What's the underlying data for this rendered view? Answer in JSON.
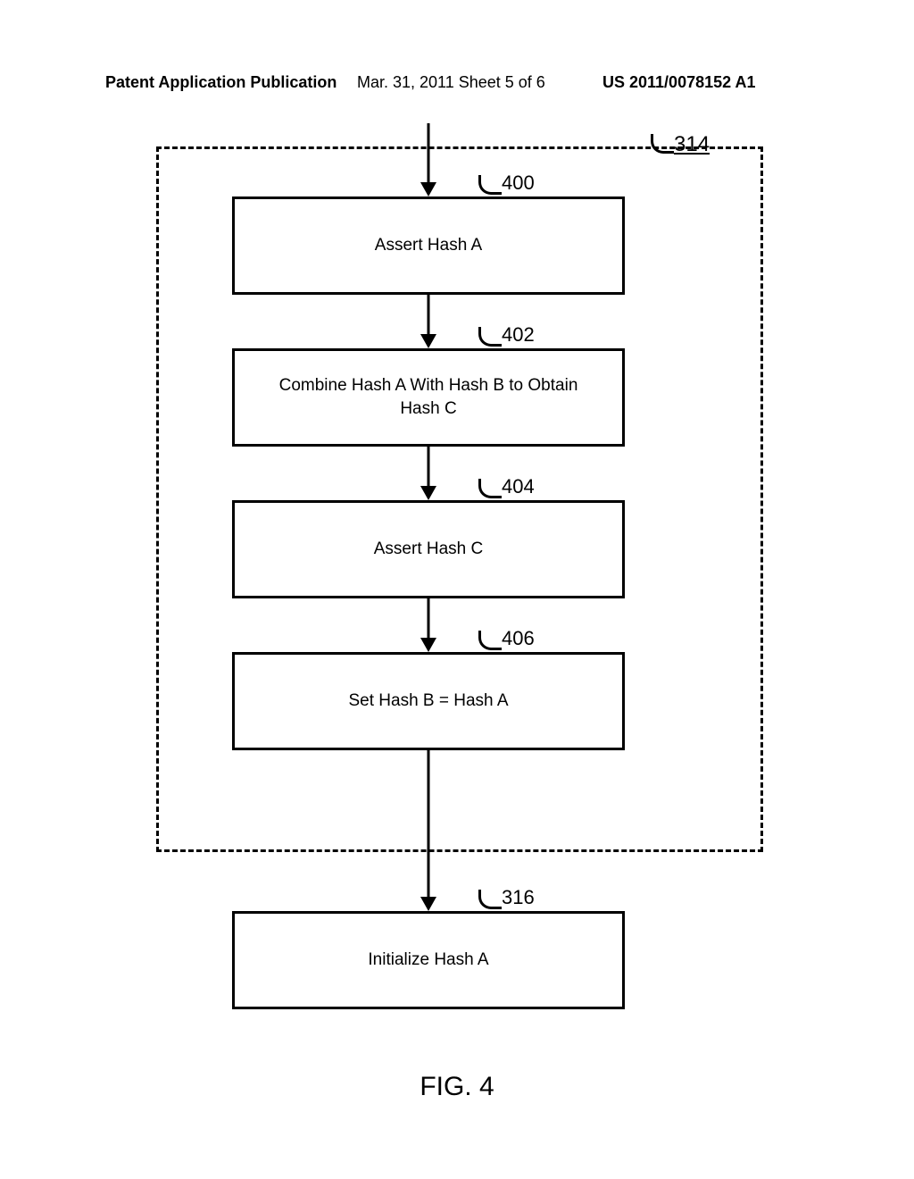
{
  "header": {
    "left": "Patent Application Publication",
    "middle": "Mar. 31, 2011  Sheet 5 of 6",
    "right": "US 2011/0078152 A1"
  },
  "refs": {
    "r314": "314",
    "r400": "400",
    "r402": "402",
    "r404": "404",
    "r406": "406",
    "r316": "316"
  },
  "steps": {
    "s400": "Assert Hash A",
    "s402": "Combine Hash A With Hash B to Obtain Hash C",
    "s404": "Assert Hash C",
    "s406": "Set Hash B = Hash A",
    "s316": "Initialize Hash A"
  },
  "caption": "FIG. 4"
}
